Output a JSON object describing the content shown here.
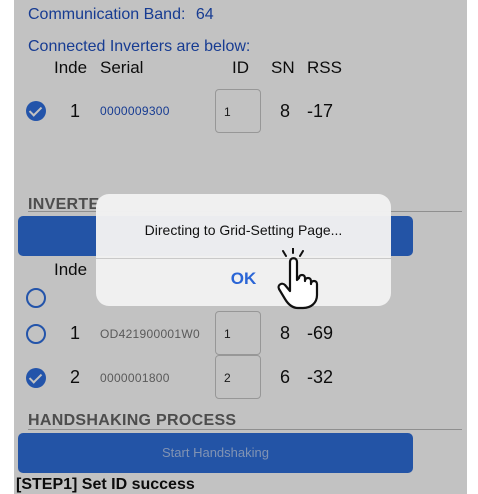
{
  "header": {
    "band_label": "Communication Band:",
    "band_value": "64",
    "connected_label": "Connected Inverters are below:"
  },
  "table_headers": {
    "index": "Inde",
    "serial": "Serial",
    "id": "ID",
    "sn": "SN",
    "rss": "RSS"
  },
  "connected_inverters": [
    {
      "index": "1",
      "serial": "0000009300",
      "id": "1",
      "sn": "8",
      "rss": "-17",
      "selected": true
    }
  ],
  "inverter_section": {
    "title": "INVERTE",
    "button_label": "",
    "index_header": "Inde"
  },
  "scan_rows": [
    {
      "index": "",
      "serial": "",
      "id": "",
      "sn": "",
      "rss": "",
      "selected": false
    },
    {
      "index": "1",
      "serial": "OD421900001W0",
      "id": "1",
      "sn": "8",
      "rss": "-69",
      "selected": false
    },
    {
      "index": "2",
      "serial": "0000001800",
      "id": "2",
      "sn": "6",
      "rss": "-32",
      "selected": true
    }
  ],
  "handshaking": {
    "title": "HANDSHAKING PROCESS",
    "button_label": "Start Handshaking",
    "status": "[STEP1] Set ID success"
  },
  "dialog": {
    "message": "Directing to Grid-Setting Page...",
    "ok_label": "OK"
  },
  "colors": {
    "accent": "#2f6fdb",
    "link_blue": "#1f4fc0",
    "dialog_ok": "#2a65d6"
  },
  "icons": {
    "checkbox_checked": "checkmark-circle-icon",
    "radio_unchecked": "radio-circle-icon",
    "pointer": "hand-pointer-icon"
  }
}
